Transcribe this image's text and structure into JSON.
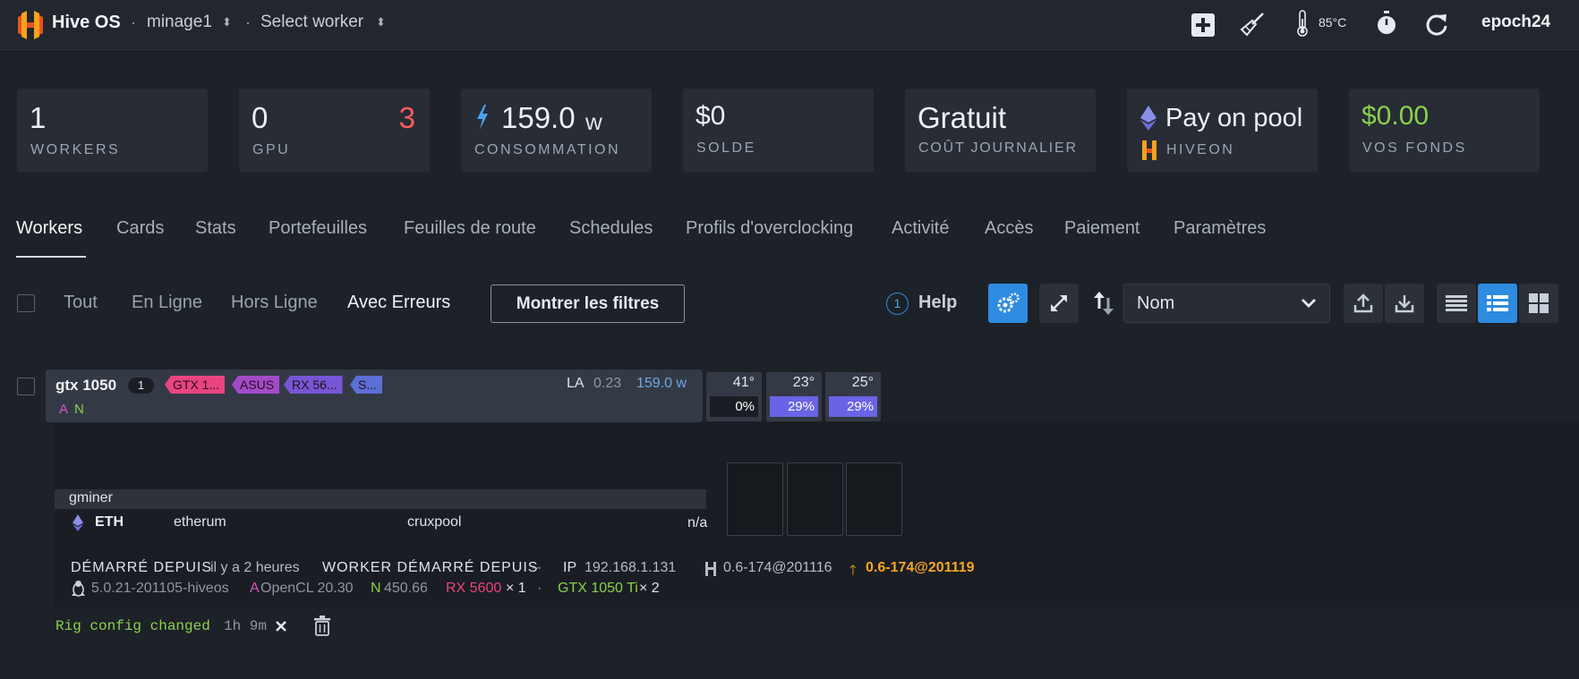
{
  "header": {
    "brand": "Hive OS",
    "farm": "minage1",
    "worker_select": "Select worker",
    "temperature": "85°C",
    "user": "epoch24",
    "icons": [
      "plus-icon",
      "broom-icon",
      "thermometer-icon",
      "stopwatch-icon",
      "refresh-icon"
    ]
  },
  "stats": {
    "workers": {
      "value": "1",
      "label": "WORKERS"
    },
    "gpu": {
      "value": "0",
      "alert": "3",
      "label": "GPU"
    },
    "consumption": {
      "value": "159.0",
      "unit": "w",
      "label": "CONSOMMATION"
    },
    "balance": {
      "value": "$0",
      "label": "SOLDE"
    },
    "daily_cost": {
      "value": "Gratuit",
      "label": "COÛT JOURNALIER"
    },
    "pay": {
      "value": "Pay on pool",
      "label": "HIVEON"
    },
    "funds": {
      "value": "$0.00",
      "label": "VOS FONDS"
    }
  },
  "tabs": [
    "Workers",
    "Cards",
    "Stats",
    "Portefeuilles",
    "Feuilles de route",
    "Schedules",
    "Profils d'overclocking",
    "Activité",
    "Accès",
    "Paiement",
    "Paramètres"
  ],
  "filters": {
    "all": "Tout",
    "online": "En Ligne",
    "offline": "Hors Ligne",
    "errors": "Avec Erreurs",
    "show_filters": "Montrer les filtres",
    "help_count": "1",
    "help": "Help",
    "sort": "Nom"
  },
  "worker": {
    "name": "gtx 1050",
    "count": "1",
    "tags": [
      "GTX 1...",
      "ASUS",
      "RX 56...",
      "S..."
    ],
    "flag_a": "A",
    "flag_n": "N",
    "la_label": "LA",
    "la_value": "0.23",
    "power": "159.0 w",
    "gpus": [
      {
        "temp": "41°",
        "fan": "0%",
        "fan_level": 0
      },
      {
        "temp": "23°",
        "fan": "29%",
        "fan_level": 29
      },
      {
        "temp": "25°",
        "fan": "29%",
        "fan_level": 29
      }
    ],
    "miner": "gminer",
    "coin": "ETH",
    "wallet": "etherum",
    "pool": "cruxpool",
    "hashrate": "n/a",
    "started_label": "DÉMARRÉ DEPUIS",
    "started_value": "il y a 2 heures",
    "worker_started_label": "WORKER DÉMARRÉ DEPUIS",
    "worker_started_value": "--",
    "ip_label": "IP",
    "ip_value": "192.168.1.131",
    "version": "0.6-174@201116",
    "update": "0.6-174@201119",
    "kernel": "5.0.21-201105-hiveos",
    "opencl_a": "A",
    "opencl": "OpenCL 20.30",
    "nvidia_n": "N",
    "nvidia": "450.66",
    "gpu_rx": "RX 5600",
    "gpu_rx_count": "× 1",
    "sep": "·",
    "gpu_gtx": "GTX 1050 Ti",
    "gpu_gtx_count": "× 2",
    "message": "Rig config changed",
    "message_time": "1h 9m"
  },
  "colors": {
    "accent_blue": "#2e8be0",
    "alert_red": "#ff5c5c",
    "green": "#8bd14a",
    "orange": "#f5a623",
    "tag_pink": "#e8457f",
    "tag_purple": "#a24bc9",
    "tag_violet": "#7557d6",
    "tag_blue": "#5b6fd6"
  }
}
